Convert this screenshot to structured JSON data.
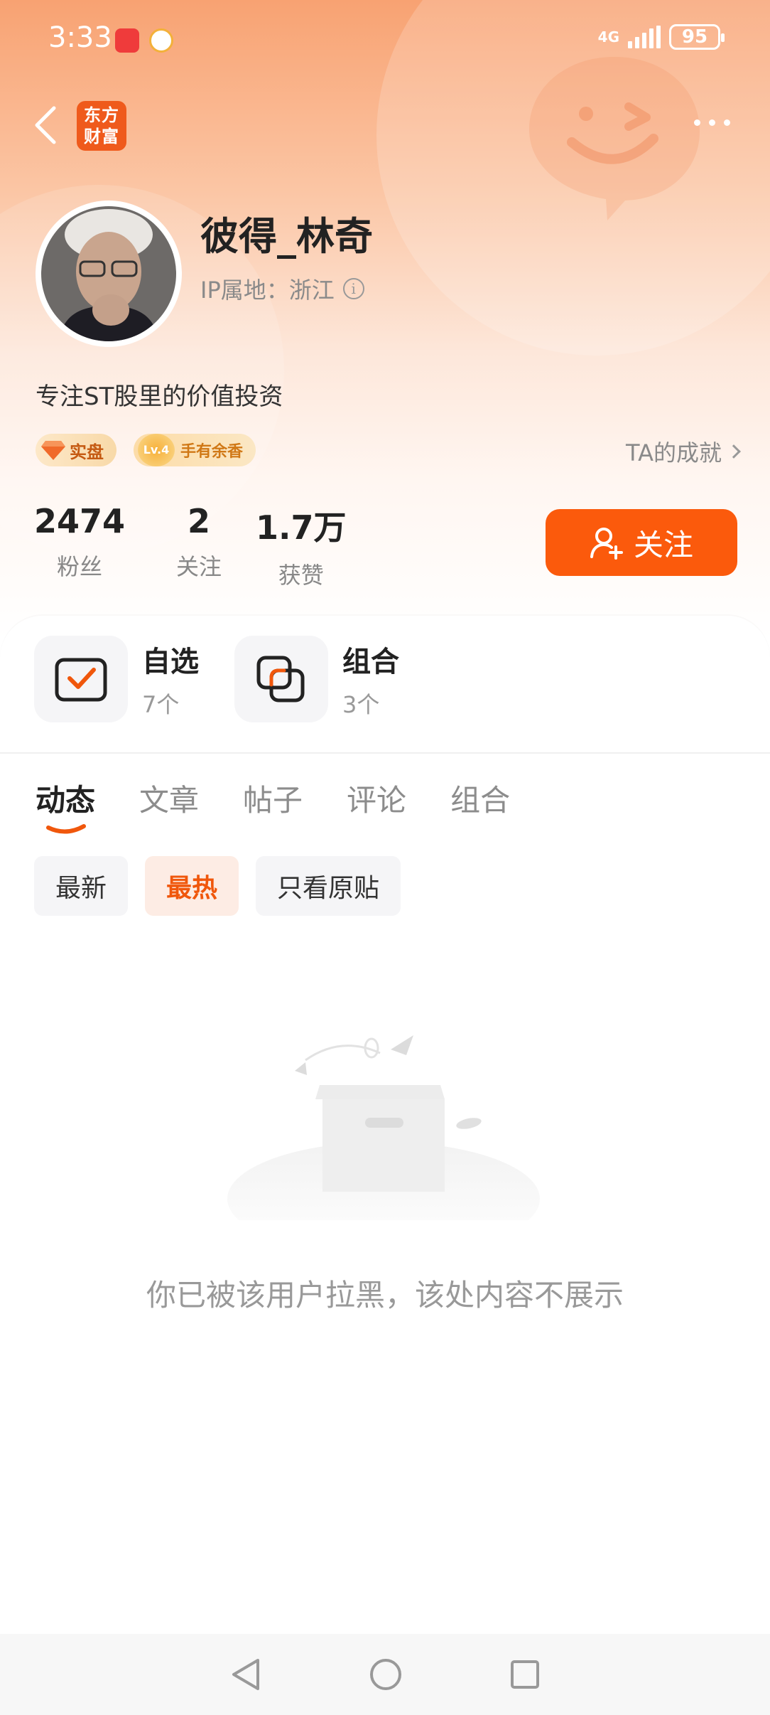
{
  "status_bar": {
    "time": "3:33",
    "network": "4G",
    "battery": "95"
  },
  "nav": {
    "logo_line1": "东方",
    "logo_line2": "财富"
  },
  "profile": {
    "username": "彼得_林奇",
    "ip_label": "IP属地：浙江",
    "bio": "专注ST股里的价值投资",
    "badge_shipan": "实盘",
    "badge_lv_level": "Lv.4",
    "badge_lv_text": "手有余香",
    "achievement_link": "TA的成就"
  },
  "stats": [
    {
      "value": "2474",
      "label": "粉丝"
    },
    {
      "value": "2",
      "label": "关注"
    },
    {
      "value": "1.7万",
      "label": "获赞"
    }
  ],
  "follow_button": "关注",
  "portfolio": [
    {
      "title": "自选",
      "count": "7个",
      "icon": "watchlist-icon"
    },
    {
      "title": "组合",
      "count": "3个",
      "icon": "portfolio-icon"
    }
  ],
  "tabs": [
    {
      "label": "动态",
      "active": true
    },
    {
      "label": "文章",
      "active": false
    },
    {
      "label": "帖子",
      "active": false
    },
    {
      "label": "评论",
      "active": false
    },
    {
      "label": "组合",
      "active": false
    }
  ],
  "filters": [
    {
      "label": "最新",
      "active": false
    },
    {
      "label": "最热",
      "active": true
    },
    {
      "label": "只看原贴",
      "active": false
    }
  ],
  "empty_state": {
    "message": "你已被该用户拉黑，该处内容不展示"
  },
  "colors": {
    "accent": "#fb5a0c",
    "header_top": "#f8a272"
  }
}
